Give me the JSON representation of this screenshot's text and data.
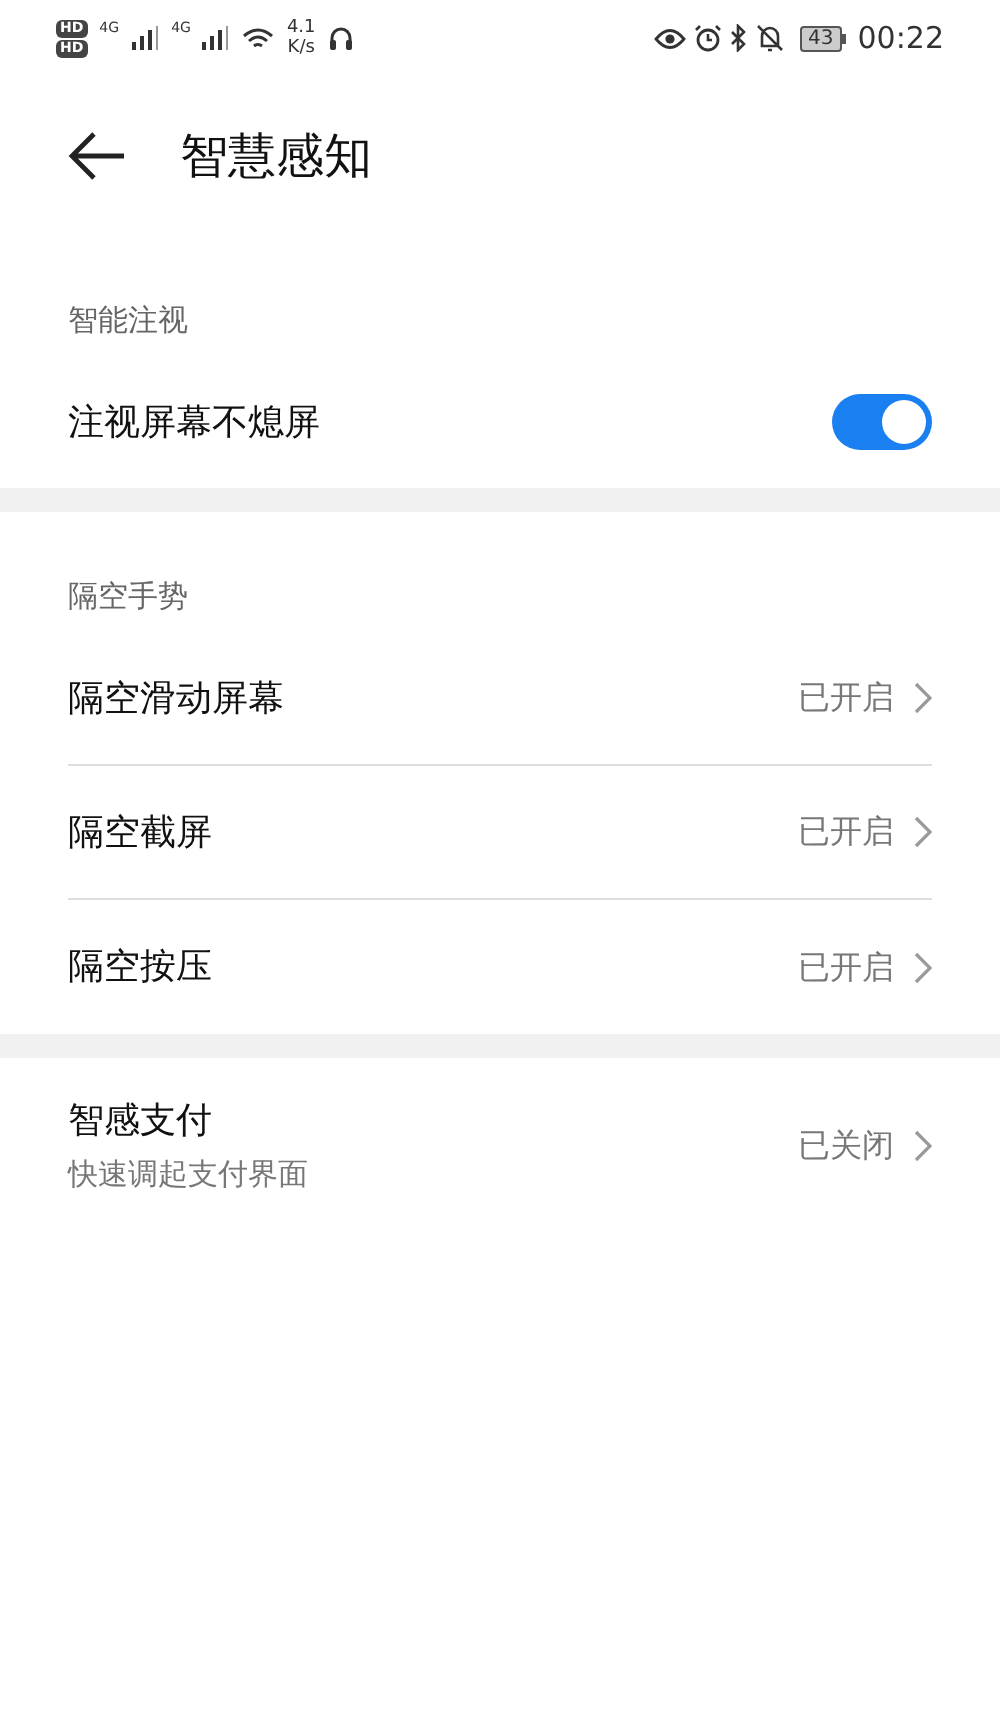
{
  "status_bar": {
    "sim_badges": [
      "HD",
      "HD"
    ],
    "networks": [
      "4G",
      "4G"
    ],
    "speed_value": "4.1",
    "speed_unit": "K/s",
    "battery": "43",
    "time": "00:22"
  },
  "header": {
    "title": "智慧感知"
  },
  "groups": [
    {
      "header": "智能注视",
      "items": [
        {
          "kind": "toggle",
          "label": "注视屏幕不熄屏",
          "on": true
        }
      ]
    },
    {
      "header": "隔空手势",
      "items": [
        {
          "kind": "link",
          "label": "隔空滑动屏幕",
          "value": "已开启"
        },
        {
          "kind": "link",
          "label": "隔空截屏",
          "value": "已开启"
        },
        {
          "kind": "link",
          "label": "隔空按压",
          "value": "已开启"
        }
      ]
    },
    {
      "items": [
        {
          "kind": "link",
          "label": "智感支付",
          "subtitle": "快速调起支付界面",
          "value": "已关闭"
        }
      ]
    }
  ]
}
